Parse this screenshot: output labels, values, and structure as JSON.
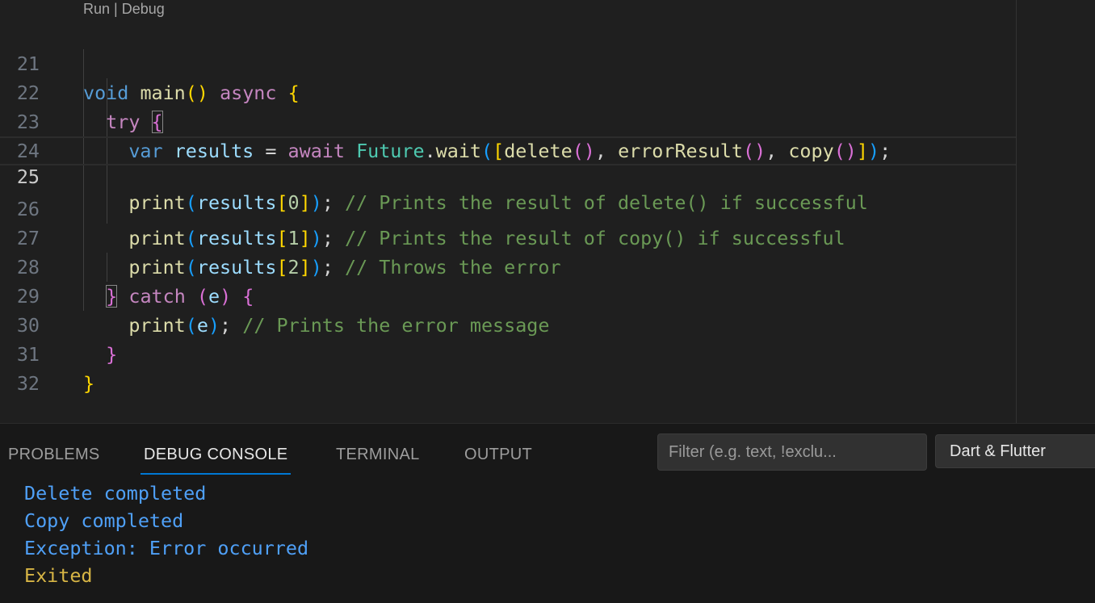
{
  "editor": {
    "codelens": {
      "run": "Run",
      "separator": "|",
      "debug": "Debug"
    },
    "line_numbers": [
      "21",
      "22",
      "23",
      "24",
      "25",
      "26",
      "27",
      "28",
      "29",
      "30",
      "31",
      "32"
    ],
    "current_line": "25",
    "tokens": {
      "void": "void",
      "main": "main",
      "async": "async",
      "try": "try",
      "var": "var",
      "results": "results",
      "eq": "=",
      "await": "await",
      "future": "Future",
      "dot": ".",
      "wait": "wait",
      "delete": "delete",
      "comma": ",",
      "errorResult": "errorResult",
      "copy": "copy",
      "semi": ";",
      "print": "print",
      "idx0": "0",
      "idx1": "1",
      "idx2": "2",
      "comment25": "// Prints the result of delete() if successful",
      "comment26": "// Prints the result of copy() if successful",
      "comment27": "// Throws the error",
      "catch": "catch",
      "e": "e",
      "comment29": "// Prints the error message",
      "lparen": "(",
      "rparen": ")",
      "lbrace": "{",
      "rbrace": "}",
      "lbrack": "[",
      "rbrack": "]"
    }
  },
  "panel": {
    "tabs": [
      "PROBLEMS",
      "DEBUG CONSOLE",
      "TERMINAL",
      "OUTPUT"
    ],
    "active_tab": "DEBUG CONSOLE",
    "filter_placeholder": "Filter (e.g. text, !exclu...",
    "source_select": "Dart & Flutter",
    "output": [
      {
        "text": "Delete completed",
        "color": "#4fa0f7"
      },
      {
        "text": "Copy completed",
        "color": "#4fa0f7"
      },
      {
        "text": "Exception: Error occurred",
        "color": "#4fa0f7"
      },
      {
        "text": "Exited",
        "color": "#d7b545"
      }
    ]
  }
}
